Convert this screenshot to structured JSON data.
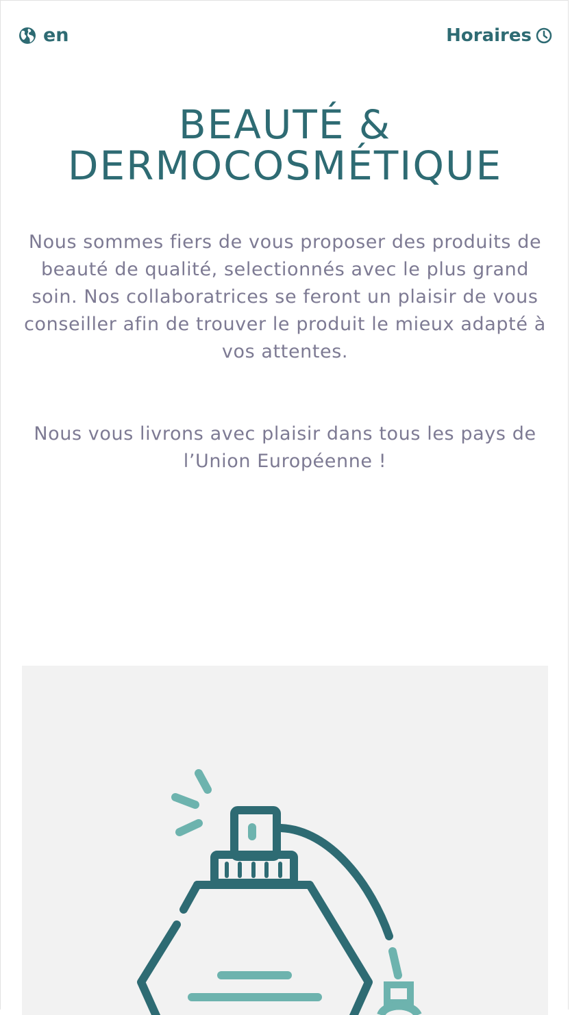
{
  "header": {
    "language_label": "en",
    "hours_label": "Horaires"
  },
  "main": {
    "title_line1": "BEAUTÉ &",
    "title_line2": "DERMOCOSMÉTIQUE",
    "intro_text": "Nous sommes fiers de vous proposer des produits de beauté de qualité, selectionnés avec le plus grand soin. Nos collaboratrices se feront un plaisir de vous conseiller afin de trouver le produit le mieux adapté à vos attentes.",
    "shipping_text": "Nous vous livrons avec plaisir dans tous les pays de l’Union Européenne !"
  },
  "icons": {
    "language": "globe-icon",
    "hours": "clock-icon",
    "illustration": "perfume-bottle-icon"
  },
  "colors": {
    "primary": "#2e6b73",
    "accent": "#6db3ae",
    "text": "#7d7a93",
    "panel_background": "#f2f2f2"
  }
}
